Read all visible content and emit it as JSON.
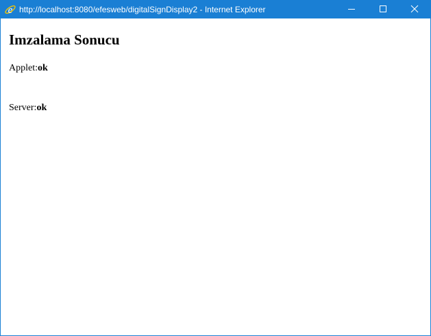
{
  "window": {
    "title": "http://localhost:8080/efesweb/digitalSignDisplay2 - Internet Explorer",
    "icon": "internet-explorer-icon",
    "controls": [
      "minimize-icon",
      "maximize-icon",
      "close-icon"
    ],
    "accent_color": "#1a7fd4"
  },
  "page": {
    "heading": "Imzalama Sonucu",
    "results": [
      {
        "label": "Applet:",
        "value": "ok"
      },
      {
        "label": "Server:",
        "value": "ok"
      }
    ]
  }
}
